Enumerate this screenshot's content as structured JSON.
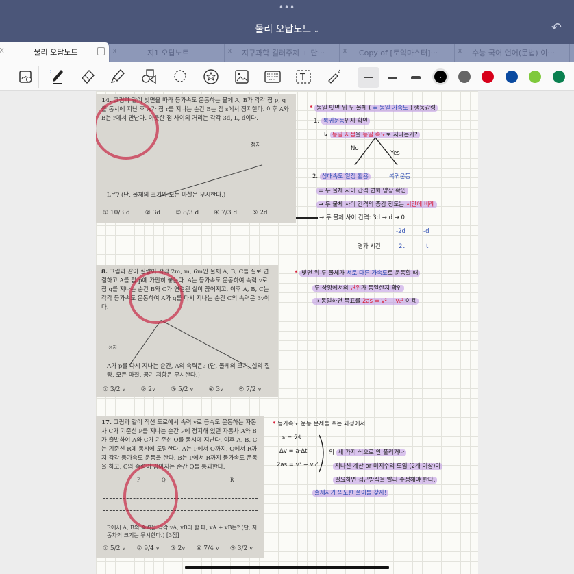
{
  "header": {
    "title": "물리 오답노트",
    "dots": "•••",
    "undo_icon": "undo-icon"
  },
  "tabs": [
    {
      "label": "물리 오답노트",
      "active": true
    },
    {
      "label": "지1 오답노트"
    },
    {
      "label": "지구과학 킬러주제 + 단···"
    },
    {
      "label": "Copy of [토익마스터]···"
    },
    {
      "label": "수능 국어 언어(문법) 이···"
    }
  ],
  "tab_close": "X",
  "toolbar": {
    "tools": [
      "zoom-window-icon",
      "pen-icon",
      "eraser-icon",
      "highlighter-icon",
      "shapes-icon",
      "lasso-icon",
      "sticker-icon",
      "image-icon",
      "keyboard-icon",
      "text-box-icon",
      "laser-pointer-icon"
    ],
    "stroke_sizes": [
      "thin",
      "medium",
      "thick"
    ],
    "colors": [
      "#000000",
      "#666666",
      "#d7001a",
      "#0a4aa0",
      "#7fc93c",
      "#0a8050"
    ],
    "selected_color": "#000000"
  },
  "problems": [
    {
      "number": "14.",
      "text": "그림과 같이 빗면을 따라 등가속도 운동하는 물체 A, B가 각각 점 p, q를 동시에 지난 후 A가 점 r를 지나는 순간 B는 점 s에서 정지한다. 이후 A와 B는 r에서 만난다. 이웃한 점 사이의 거리는 각각 3d, L, d이다.",
      "question": "L은? (단, 물체의 크기와 모든 마찰은 무시한다.)",
      "choices": [
        "① 10/3 d",
        "② 3d",
        "③ 8/3 d",
        "④ 7/3 d",
        "⑤ 2d"
      ],
      "diagram_label": "정지"
    },
    {
      "number": "8.",
      "text": "그림과 같이 질량이 각각 2m, m, 6m인 물체 A, B, C를 실로 연결하고 A를 점 p에 가만히 놓는다. A는 등가속도 운동하여 속력 v로 점 q를 지나는 순간 B와 C가 연결된 실이 끊어지고, 이후 A, B, C는 각각 등가속도 운동하여 A가 q를 다시 지나는 순간 C의 속력은 3v이다.",
      "question": "A가 p를 다시 지나는 순간, A의 속력은? (단, 물체의 크기, 실의 질량, 모든 마찰, 공기 저항은 무시한다.)",
      "choices": [
        "① 3/2 v",
        "② 2v",
        "③ 5/2 v",
        "④ 3v",
        "⑤ 7/2 v"
      ],
      "diagram_label": "정지"
    },
    {
      "number": "17.",
      "text": "그림과 같이 직선 도로에서 속력 v로 등속도 운동하는 자동차 C가 기준선 P를 지나는 순간 P에 정지해 있던 자동차 A와 B가 출발하여 A와 C가 기준선 Q를 동시에 지난다. 이후 A, B, C는 기준선 R에 동시에 도달한다. A는 P에서 Q까지, Q에서 R까지 각각 등가속도 운동을 한다. B는 P에서 R까지 등가속도 운동을 하고, C의 속력이 감아지는 순간 Q를 통과한다.",
      "question": "R에서 A, B의 속력을 각각 vA, vB라 할 때, vA + vB는? (단, 자동차의 크기는 무시한다.) [3점]",
      "choices": [
        "① 5/2 v",
        "② 9/4 v",
        "③ 2v",
        "④ 7/4 v",
        "⑤ 3/2 v"
      ],
      "diagram_labels": [
        "P",
        "Q",
        "R"
      ]
    }
  ],
  "notes": {
    "n1": {
      "title_pre": "동일 빗면 위 두 물체 (",
      "title_hl": "= 동일 가속도",
      "title_post": ") 행동강령",
      "step1_num": "1.",
      "step1_hl": "복귀운동",
      "step1_rest": "인지 확인",
      "q_pre": "동일 지점",
      "q_mid1": "을 ",
      "q_mid2": "동일 속도",
      "q_post": "로 지나는가?",
      "no": "No",
      "yes": "Yes",
      "step2_num": "2.",
      "step2_hl": "상대속도 일정 활용",
      "yes_result": "복귀운동",
      "line_a": "= 두 물체 사이 간격 변화 양상 확인",
      "line_b_pre": "→ 두 물체 사이 간격의 증감 정도는 ",
      "line_b_red": "시간에 비례",
      "line_c": "두 물체 사이 간격:  3d → d → 0",
      "diff1": "-2d",
      "diff2": "-d",
      "time_label": "경과 시간:",
      "t1": "2t",
      "t2": "t"
    },
    "n2": {
      "l1_pre": "빗면 위 두 물체가 ",
      "l1_blue": "서로 다른 가속도",
      "l1_post": "로 운동할 때",
      "l2_pre": "두 상황에서의 ",
      "l2_red": "변위",
      "l2_post": "가 동일한지 확인",
      "l3_pre": "→ 동일하면 목표를 ",
      "l3_red": "2as = v² − v₀²",
      "l3_post": " 이용"
    },
    "n3": {
      "l1": "등가속도 운동 문제를 푸는 과정에서",
      "eq1": "s = v̄·t",
      "eq2": "Δv = a·Δt",
      "eq3": "2as = v² − v₀²",
      "l2_pre": "의 ",
      "l2": "세 가지 식으로 안 풀리거나",
      "l3": "지나친 계산 or 미지수의 도입 (2개 이상)이",
      "l4": "필요하면 접근방식을 빨리 수정해야 한다.",
      "l5": "출제자가 의도한 풀이를 찾자!"
    }
  }
}
